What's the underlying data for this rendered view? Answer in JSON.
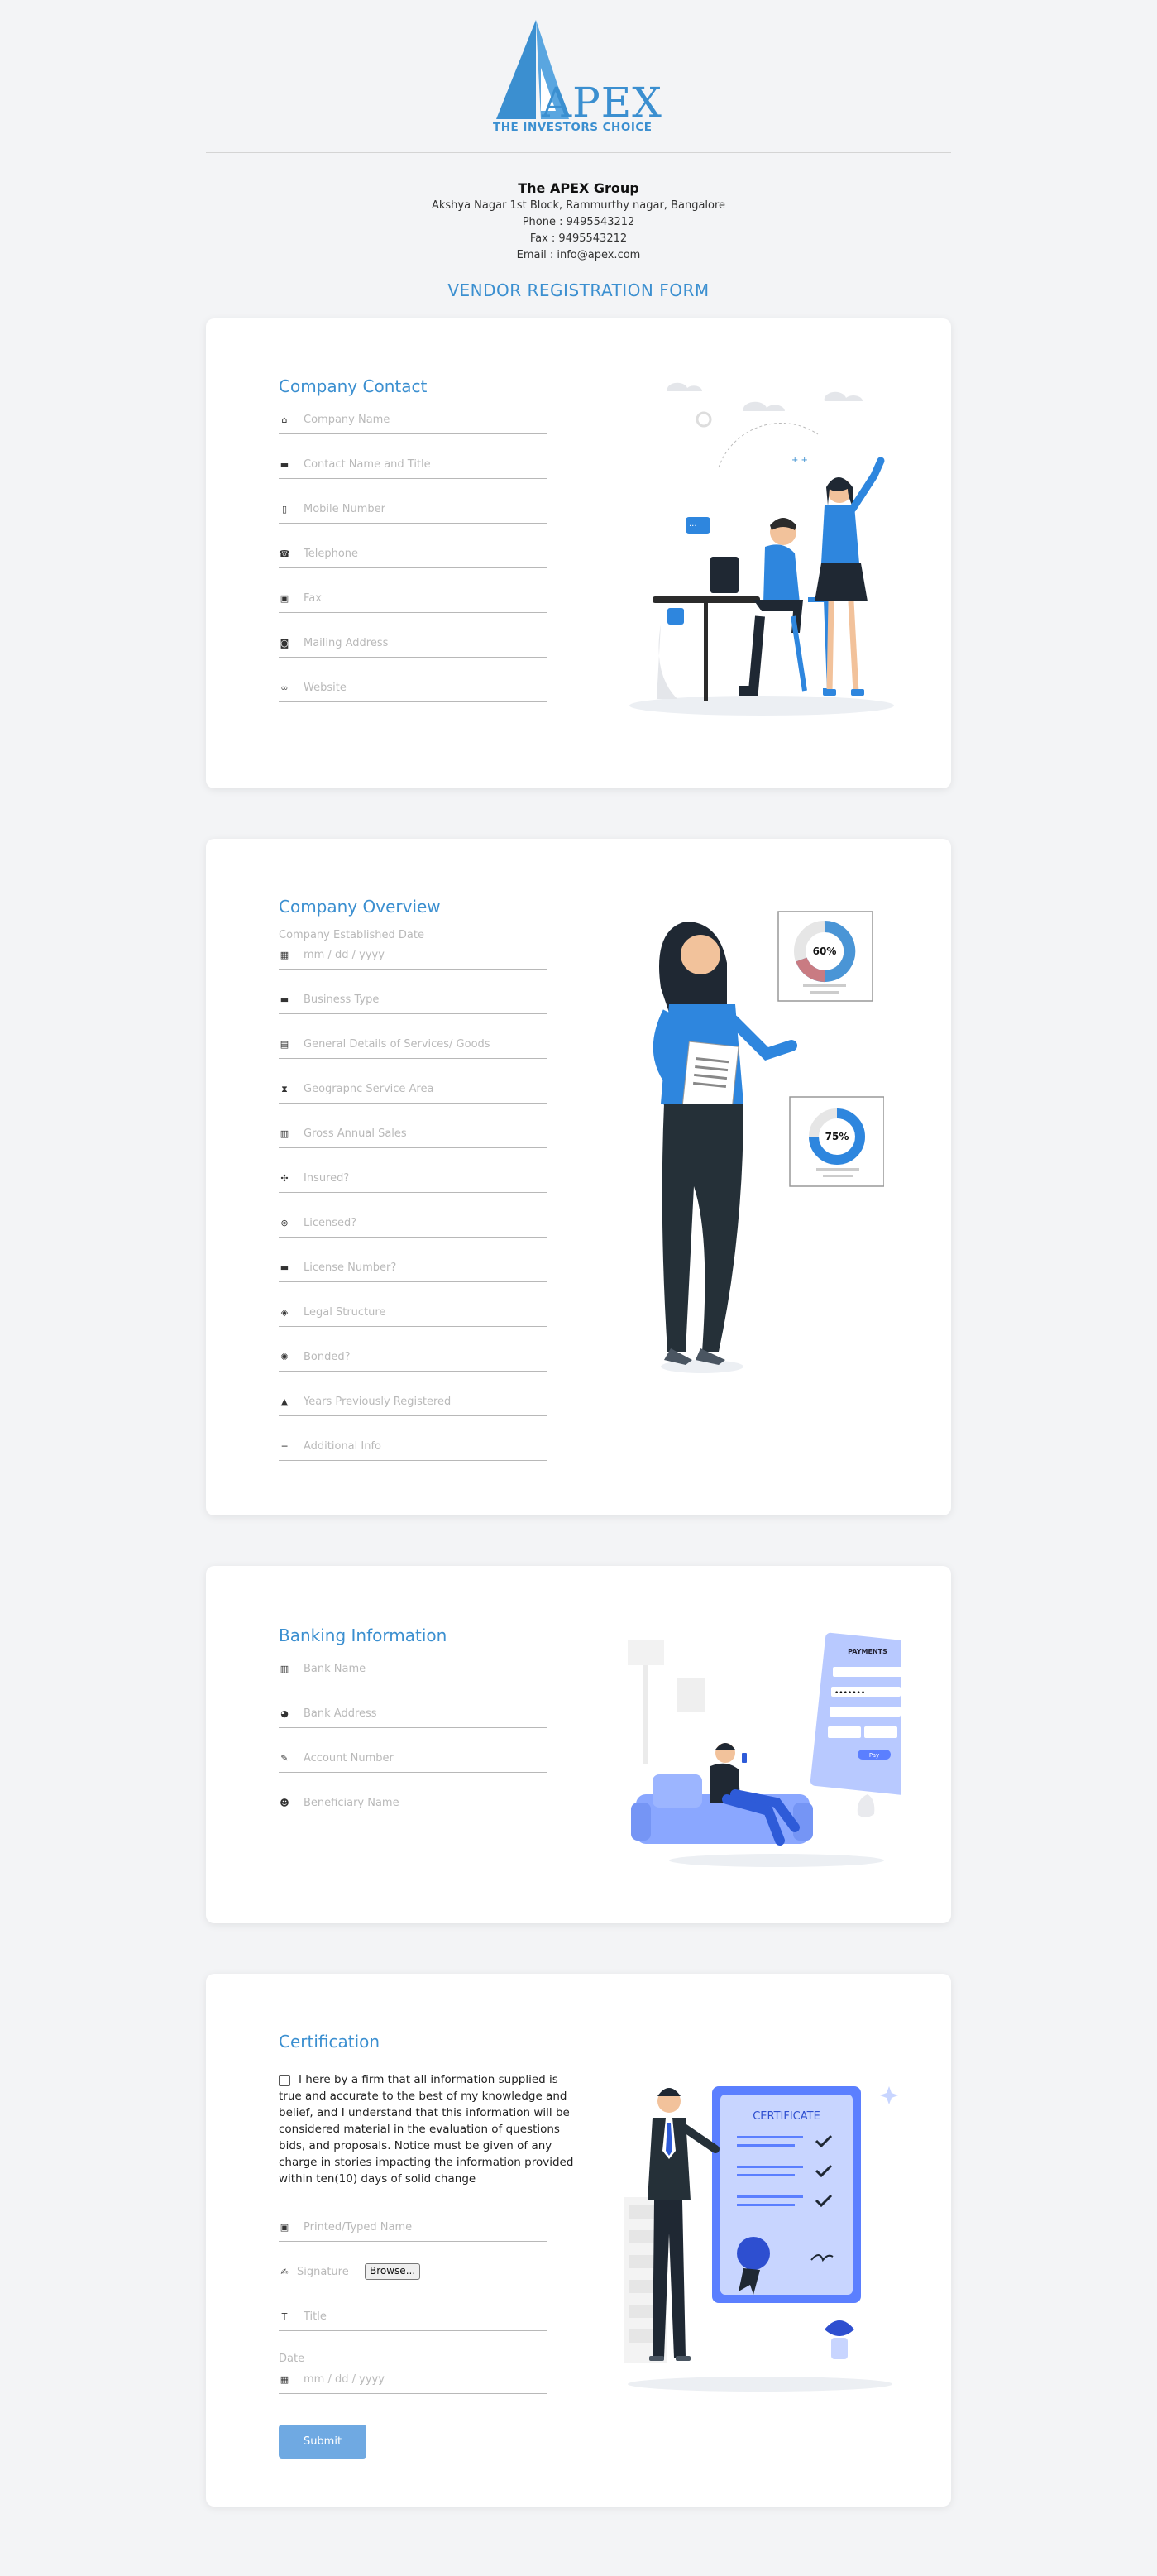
{
  "logo": {
    "wordmark": "APEX",
    "tagline": "THE INVESTORS CHOICE"
  },
  "company": {
    "name": "The APEX Group",
    "address": "Akshya Nagar 1st Block, Rammurthy nagar, Bangalore",
    "phone": "Phone : 9495543212",
    "fax": "Fax : 9495543212",
    "email": "Email : info@apex.com"
  },
  "form_title": "VENDOR REGISTRATION FORM",
  "contact": {
    "title": "Company Contact",
    "fields": [
      {
        "icon": "home-icon",
        "placeholder": "Company Name"
      },
      {
        "icon": "id-card-icon",
        "placeholder": "Contact Name and Title"
      },
      {
        "icon": "mobile-icon",
        "placeholder": "Mobile Number"
      },
      {
        "icon": "phone-icon",
        "placeholder": "Telephone"
      },
      {
        "icon": "fax-icon",
        "placeholder": "Fax"
      },
      {
        "icon": "address-book-icon",
        "placeholder": "Mailing Address"
      },
      {
        "icon": "link-icon",
        "placeholder": "Website"
      }
    ]
  },
  "overview": {
    "title": "Company Overview",
    "date_label": "Company Established Date",
    "date_placeholder": "mm / dd / yyyy",
    "fields": [
      {
        "icon": "id-card-icon",
        "placeholder": "Business Type"
      },
      {
        "icon": "briefcase-icon",
        "placeholder": "General Details of Services/ Goods"
      },
      {
        "icon": "hourglass-icon",
        "placeholder": "Geograpnc Service Area"
      },
      {
        "icon": "chart-icon",
        "placeholder": "Gross Annual Sales"
      },
      {
        "icon": "shield-icon",
        "placeholder": "Insured?"
      },
      {
        "icon": "certificate-icon",
        "placeholder": "Licensed?"
      },
      {
        "icon": "minus-icon",
        "placeholder": "License Number?"
      },
      {
        "icon": "box-icon",
        "placeholder": "Legal Structure"
      },
      {
        "icon": "sun-icon",
        "placeholder": "Bonded?"
      },
      {
        "icon": "bell-icon",
        "placeholder": "Years Previously Registered"
      },
      {
        "icon": "dash-icon",
        "placeholder": "Additional Info"
      }
    ],
    "chart_labels": [
      "60%",
      "75%"
    ]
  },
  "banking": {
    "title": "Banking Information",
    "fields": [
      {
        "icon": "building-icon",
        "placeholder": "Bank Name"
      },
      {
        "icon": "location-icon",
        "placeholder": "Bank Address"
      },
      {
        "icon": "pen-icon",
        "placeholder": "Account Number"
      },
      {
        "icon": "users-icon",
        "placeholder": "Beneficiary Name"
      }
    ],
    "payment": {
      "heading": "PAYMENTS",
      "pay": "Pay"
    }
  },
  "certification": {
    "title": "Certification",
    "statement": "I here by a firm that all information supplied is true and accurate to the best of my knowledge and belief, and I understand that this information will be considered material in the evaluation of questions bids, and proposals. Notice must be given of any charge in stories impacting the information provided within ten(10) days of solid change",
    "printed_name": "Printed/Typed Name",
    "signature": "Signature",
    "browse": "Browse...",
    "title_field": "Title",
    "date_label": "Date",
    "date_placeholder": "mm / dd / yyyy",
    "submit": "Submit",
    "certificate_heading": "CERTIFICATE"
  },
  "colors": {
    "accent": "#3b8fd0",
    "button": "#6fa9e2",
    "illustration": "#2e86de",
    "illustration_alt": "#5b7fff"
  }
}
